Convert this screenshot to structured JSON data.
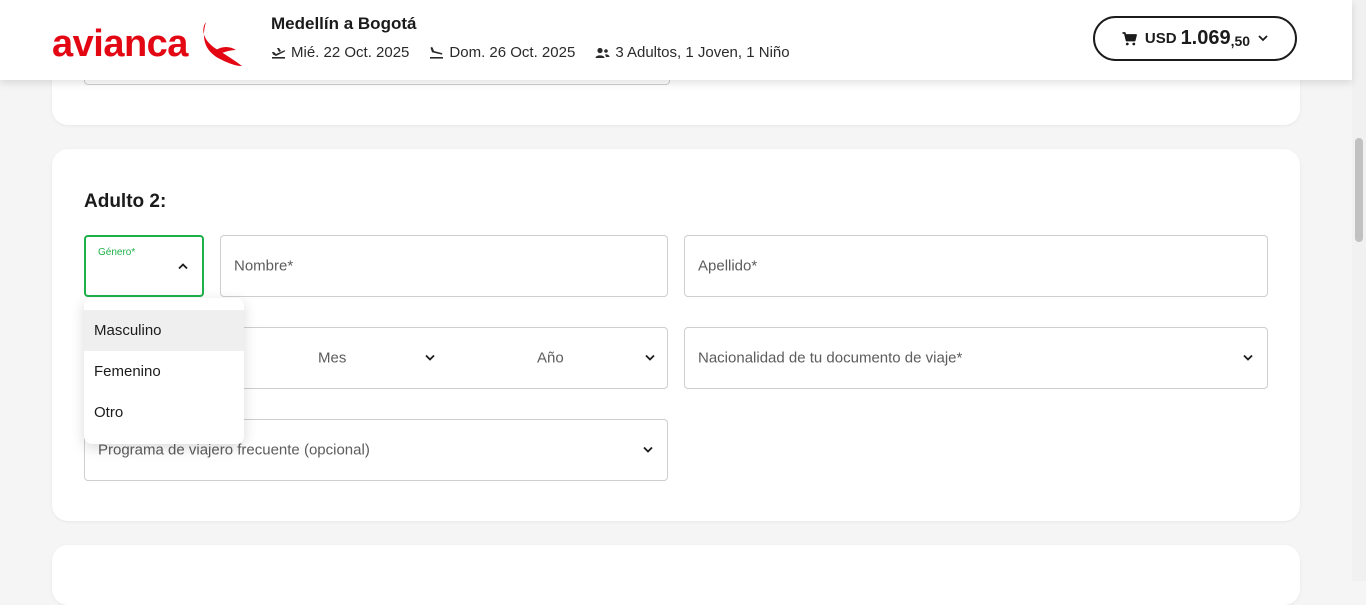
{
  "brand": {
    "name": "avianca",
    "color": "#e30613"
  },
  "header": {
    "route": "Medellín a Bogotá",
    "departure": "Mié. 22 Oct. 2025",
    "return": "Dom. 26 Oct. 2025",
    "passengers": "3 Adultos, 1 Joven, 1 Niño",
    "cart": {
      "currency": "USD",
      "amount": "1.069",
      "decimals": ",50"
    }
  },
  "form": {
    "section_title": "Adulto 2:",
    "genero": {
      "label": "Género*"
    },
    "nombre": {
      "placeholder": "Nombre*"
    },
    "apellido": {
      "placeholder": "Apellido*"
    },
    "fecha": {
      "mes": "Mes",
      "anio": "Año"
    },
    "nacionalidad": {
      "placeholder": "Nacionalidad de tu documento de viaje*"
    },
    "programa": {
      "placeholder": "Programa de viajero frecuente (opcional)"
    },
    "genero_options": [
      "Masculino",
      "Femenino",
      "Otro"
    ],
    "accent_color": "#1eb14a"
  },
  "icons": {
    "departure": "plane-takeoff-icon",
    "return": "plane-landing-icon",
    "passengers": "passengers-icon",
    "cart": "cart-icon"
  }
}
